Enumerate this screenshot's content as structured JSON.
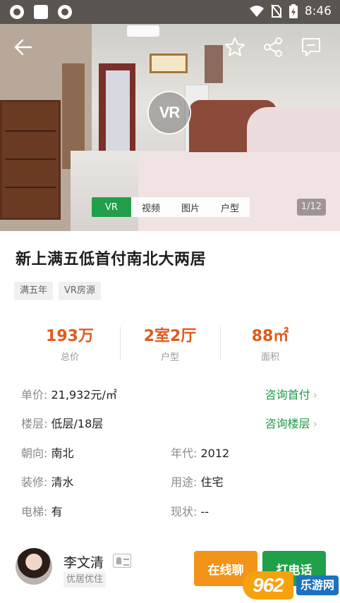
{
  "status_bar": {
    "time": "8:46"
  },
  "hero": {
    "badge": "VR",
    "media_tabs": [
      {
        "label": "VR",
        "active": true
      },
      {
        "label": "视频",
        "active": false
      },
      {
        "label": "图片",
        "active": false
      },
      {
        "label": "户型",
        "active": false
      }
    ],
    "page_counter": "1/12"
  },
  "listing": {
    "title": "新上满五低首付南北大两居",
    "tags": [
      "满五年",
      "VR房源"
    ],
    "stats": [
      {
        "value": "193万",
        "label": "总价"
      },
      {
        "value": "2室2厅",
        "label": "户型"
      },
      {
        "value": "88㎡",
        "label": "面积"
      }
    ],
    "details": {
      "unit_price_label": "单价:",
      "unit_price": "21,932元/㎡",
      "consult_down_payment": "咨询首付",
      "floor_label": "楼层:",
      "floor": "低层/18层",
      "consult_floor": "咨询楼层",
      "orientation_label": "朝向:",
      "orientation": "南北",
      "year_label": "年代:",
      "year": "2012",
      "decoration_label": "装修:",
      "decoration": "清水",
      "usage_label": "用途:",
      "usage": "住宅",
      "elevator_label": "电梯:",
      "elevator": "有",
      "status_label": "现状:",
      "status": "--"
    }
  },
  "agent": {
    "name": "李文清",
    "company": "优居优住",
    "chat_button": "在线聊",
    "call_button": "打电话"
  },
  "watermark": {
    "mark": "962",
    "text": "乐游网"
  },
  "colors": {
    "accent_green": "#21a049",
    "accent_orange": "#f29418",
    "price_orange": "#e05a1c"
  }
}
